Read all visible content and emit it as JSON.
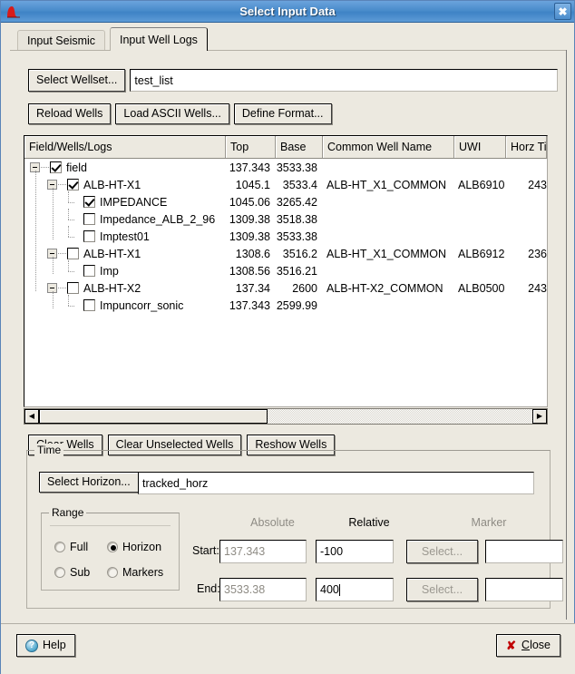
{
  "window": {
    "title": "Select Input Data",
    "icon": "app-histogram-icon",
    "close_label": "✖"
  },
  "tabs": [
    {
      "label": "Input Seismic",
      "active": false
    },
    {
      "label": "Input Well Logs",
      "active": true
    }
  ],
  "wellset": {
    "button_label": "Select Wellset...",
    "value": "test_list",
    "placeholder": ""
  },
  "toolbar": {
    "reload_wells": "Reload Wells",
    "load_ascii_wells": "Load ASCII Wells...",
    "define_format": "Define Format..."
  },
  "tree": {
    "columns": [
      {
        "key": "name",
        "label": "Field/Wells/Logs"
      },
      {
        "key": "top",
        "label": "Top"
      },
      {
        "key": "base",
        "label": "Base"
      },
      {
        "key": "cwn",
        "label": "Common Well Name"
      },
      {
        "key": "uwi",
        "label": "UWI"
      },
      {
        "key": "hz",
        "label": "Horz Ti"
      }
    ],
    "rows": [
      {
        "level": 0,
        "expander": true,
        "checked": true,
        "name": "field",
        "top": "137.343",
        "base": "3533.38",
        "cwn": "",
        "uwi": "",
        "hz": ""
      },
      {
        "level": 1,
        "expander": true,
        "checked": true,
        "name": "ALB-HT-X1",
        "top": "1045.1",
        "base": "3533.4",
        "cwn": "ALB-HT_X1_COMMON",
        "uwi": "ALB6910",
        "hz": "243"
      },
      {
        "level": 2,
        "expander": false,
        "checked": true,
        "name": "IMPEDANCE",
        "top": "1045.06",
        "base": "3265.42",
        "cwn": "",
        "uwi": "",
        "hz": ""
      },
      {
        "level": 2,
        "expander": false,
        "checked": false,
        "name": "Impedance_ALB_2_96",
        "top": "1309.38",
        "base": "3518.38",
        "cwn": "",
        "uwi": "",
        "hz": ""
      },
      {
        "level": 2,
        "expander": false,
        "checked": false,
        "name": "Imptest01",
        "top": "1309.38",
        "base": "3533.38",
        "cwn": "",
        "uwi": "",
        "hz": ""
      },
      {
        "level": 1,
        "expander": true,
        "checked": false,
        "name": "ALB-HT-X1",
        "top": "1308.6",
        "base": "3516.2",
        "cwn": "ALB-HT_X1_COMMON",
        "uwi": "ALB6912",
        "hz": "236"
      },
      {
        "level": 2,
        "expander": false,
        "checked": false,
        "name": "Imp",
        "top": "1308.56",
        "base": "3516.21",
        "cwn": "",
        "uwi": "",
        "hz": ""
      },
      {
        "level": 1,
        "expander": true,
        "checked": false,
        "name": "ALB-HT-X2",
        "top": "137.34",
        "base": "2600",
        "cwn": "ALB-HT-X2_COMMON",
        "uwi": "ALB0500",
        "hz": "243"
      },
      {
        "level": 2,
        "expander": false,
        "checked": false,
        "name": "Impuncorr_sonic",
        "top": "137.343",
        "base": "2599.99",
        "cwn": "",
        "uwi": "",
        "hz": ""
      }
    ]
  },
  "hscrollbar": {
    "left_arrow": "◀",
    "right_arrow": "▶"
  },
  "well_actions": {
    "clear_wells": "Clear Wells",
    "clear_unselected_wells": "Clear Unselected Wells",
    "reshow_wells": "Reshow Wells"
  },
  "time": {
    "legend": "Time",
    "horizon_button": "Select Horizon...",
    "horizon_value": "tracked_horz",
    "range": {
      "legend": "Range",
      "options": [
        {
          "label": "Full",
          "selected": false
        },
        {
          "label": "Horizon",
          "selected": true
        },
        {
          "label": "Sub",
          "selected": false
        },
        {
          "label": "Markers",
          "selected": false
        }
      ]
    },
    "column_headers": {
      "absolute": "Absolute",
      "relative": "Relative",
      "marker": "Marker"
    },
    "rows": [
      {
        "label": "Start:",
        "absolute": "137.343",
        "relative": "-100",
        "marker_button": "Select...",
        "marker_value": ""
      },
      {
        "label": "End:",
        "absolute": "3533.38",
        "relative": "400",
        "marker_button": "Select...",
        "marker_value": ""
      }
    ]
  },
  "footer": {
    "help_label": "Help",
    "help_icon": "question-mark-icon",
    "close_label": "Close",
    "close_mnemonic": "C",
    "close_rest": "lose",
    "close_icon": "red-x-icon"
  },
  "colors": {
    "titlebar": "#4a8ccb",
    "face": "#ece9e0",
    "field": "#ffffff",
    "disabled_text": "#8e8b84",
    "close_x": "#c00000"
  }
}
